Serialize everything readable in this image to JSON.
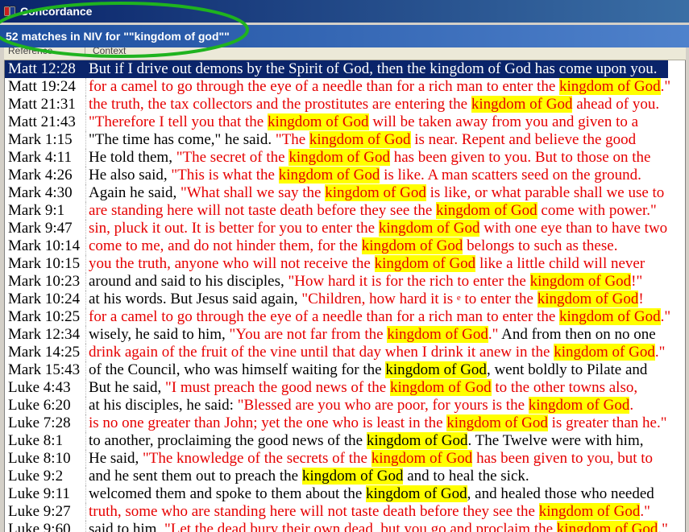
{
  "window": {
    "title": "Concordance",
    "icon": "book-icon"
  },
  "summary": "52 matches in NIV for \"\"kingdom of god\"\"",
  "columns": {
    "reference": "Reference",
    "context": "Context"
  },
  "colors": {
    "title_bar_start": "#0a246a",
    "title_bar_end": "#3a6ea5",
    "summary_bar_start": "#1d4e9e",
    "summary_bar_end": "#4f82cc",
    "selection": "#0a246a",
    "highlight": "#ffff00",
    "red_letter": "#e60000",
    "annotation": "#1fb31f"
  },
  "rows": [
    {
      "reference": "Matt 12:28",
      "selected": true,
      "segments": [
        {
          "text": "But if I drive out demons by the Spirit of God, then the kingdom of God has come upon you.",
          "color": "black"
        }
      ]
    },
    {
      "reference": "Matt 19:24",
      "segments": [
        {
          "text": "for a camel to go through the eye of a needle than for a rich man to enter the ",
          "color": "red"
        },
        {
          "text": "kingdom of God",
          "color": "red",
          "highlight": true
        },
        {
          "text": ".\"",
          "color": "red"
        }
      ]
    },
    {
      "reference": "Matt 21:31",
      "segments": [
        {
          "text": "the truth, the tax collectors and the prostitutes are entering the ",
          "color": "red"
        },
        {
          "text": "kingdom of God",
          "color": "red",
          "highlight": true
        },
        {
          "text": " ahead of you.",
          "color": "red"
        }
      ]
    },
    {
      "reference": "Matt 21:43",
      "segments": [
        {
          "text": "\"Therefore I tell you that the ",
          "color": "red"
        },
        {
          "text": "kingdom of God",
          "color": "red",
          "highlight": true
        },
        {
          "text": " will be taken away from you and given to a",
          "color": "red"
        }
      ]
    },
    {
      "reference": "Mark 1:15",
      "segments": [
        {
          "text": "\"The time has come,\" he said. ",
          "color": "black"
        },
        {
          "text": "\"The ",
          "color": "red"
        },
        {
          "text": "kingdom of God",
          "color": "red",
          "highlight": true
        },
        {
          "text": " is near. Repent and believe the good",
          "color": "red"
        }
      ]
    },
    {
      "reference": "Mark 4:11",
      "segments": [
        {
          "text": "He told them, ",
          "color": "black"
        },
        {
          "text": "\"The secret of the ",
          "color": "red"
        },
        {
          "text": "kingdom of God",
          "color": "red",
          "highlight": true
        },
        {
          "text": " has been given to you. But to those on the",
          "color": "red"
        }
      ]
    },
    {
      "reference": "Mark 4:26",
      "segments": [
        {
          "text": "He also said, ",
          "color": "black"
        },
        {
          "text": "\"This is what the ",
          "color": "red"
        },
        {
          "text": "kingdom of God",
          "color": "red",
          "highlight": true
        },
        {
          "text": " is like. A man scatters seed on the ground.",
          "color": "red"
        }
      ]
    },
    {
      "reference": "Mark 4:30",
      "segments": [
        {
          "text": "Again he said, ",
          "color": "black"
        },
        {
          "text": "\"What shall we say the ",
          "color": "red"
        },
        {
          "text": "kingdom of God",
          "color": "red",
          "highlight": true
        },
        {
          "text": " is like, or what parable shall we use to",
          "color": "red"
        }
      ]
    },
    {
      "reference": "Mark 9:1",
      "segments": [
        {
          "text": "are standing here will not taste death before they see the ",
          "color": "red"
        },
        {
          "text": "kingdom of God",
          "color": "red",
          "highlight": true
        },
        {
          "text": " come with power.\"",
          "color": "red"
        }
      ]
    },
    {
      "reference": "Mark 9:47",
      "segments": [
        {
          "text": "sin, pluck it out. It is better for you to enter the ",
          "color": "red"
        },
        {
          "text": "kingdom of God",
          "color": "red",
          "highlight": true
        },
        {
          "text": " with one eye than to have two",
          "color": "red"
        }
      ]
    },
    {
      "reference": "Mark 10:14",
      "segments": [
        {
          "text": "come to me, and do not hinder them, for the ",
          "color": "red"
        },
        {
          "text": "kingdom of God",
          "color": "red",
          "highlight": true
        },
        {
          "text": " belongs to such as these.",
          "color": "red"
        }
      ]
    },
    {
      "reference": "Mark 10:15",
      "segments": [
        {
          "text": "you the truth, anyone who will not receive the ",
          "color": "red"
        },
        {
          "text": "kingdom of God",
          "color": "red",
          "highlight": true
        },
        {
          "text": " like a little child will never",
          "color": "red"
        }
      ]
    },
    {
      "reference": "Mark 10:23",
      "segments": [
        {
          "text": "around and said to his disciples, ",
          "color": "black"
        },
        {
          "text": "\"How hard it is for the rich to enter the ",
          "color": "red"
        },
        {
          "text": "kingdom of God",
          "color": "red",
          "highlight": true
        },
        {
          "text": "!\"",
          "color": "red"
        }
      ]
    },
    {
      "reference": "Mark 10:24",
      "segments": [
        {
          "text": "at his words. But Jesus said again, ",
          "color": "black"
        },
        {
          "text": "\"Children, how hard it is ",
          "color": "red"
        },
        {
          "text": "e",
          "color": "red",
          "superscript": true
        },
        {
          "text": " to enter the ",
          "color": "red"
        },
        {
          "text": "kingdom of God",
          "color": "red",
          "highlight": true
        },
        {
          "text": "!",
          "color": "red"
        }
      ]
    },
    {
      "reference": "Mark 10:25",
      "segments": [
        {
          "text": "for a camel to go through the eye of a needle than for a rich man to enter the ",
          "color": "red"
        },
        {
          "text": "kingdom of God",
          "color": "red",
          "highlight": true
        },
        {
          "text": ".\"",
          "color": "red"
        }
      ]
    },
    {
      "reference": "Mark 12:34",
      "segments": [
        {
          "text": "wisely, he said to him, ",
          "color": "black"
        },
        {
          "text": "\"You are not far from the ",
          "color": "red"
        },
        {
          "text": "kingdom of God",
          "color": "red",
          "highlight": true
        },
        {
          "text": ".\"",
          "color": "red"
        },
        {
          "text": " And from then on no one",
          "color": "black"
        }
      ]
    },
    {
      "reference": "Mark 14:25",
      "segments": [
        {
          "text": "drink again of the fruit of the vine until that day when I drink it anew in the ",
          "color": "red"
        },
        {
          "text": "kingdom of God",
          "color": "red",
          "highlight": true
        },
        {
          "text": ".\"",
          "color": "red"
        }
      ]
    },
    {
      "reference": "Mark 15:43",
      "segments": [
        {
          "text": "of the Council, who was himself waiting for the ",
          "color": "black"
        },
        {
          "text": "kingdom of God",
          "color": "black",
          "highlight": true
        },
        {
          "text": ", went boldly to Pilate and",
          "color": "black"
        }
      ]
    },
    {
      "reference": "Luke 4:43",
      "segments": [
        {
          "text": "But he said, ",
          "color": "black"
        },
        {
          "text": "\"I must preach the good news of the ",
          "color": "red"
        },
        {
          "text": "kingdom of God",
          "color": "red",
          "highlight": true
        },
        {
          "text": " to the other towns also,",
          "color": "red"
        }
      ]
    },
    {
      "reference": "Luke 6:20",
      "segments": [
        {
          "text": "at his disciples, he said: ",
          "color": "black"
        },
        {
          "text": "\"Blessed are you who are poor, for yours is the ",
          "color": "red"
        },
        {
          "text": "kingdom of God",
          "color": "red",
          "highlight": true
        },
        {
          "text": ".",
          "color": "red"
        }
      ]
    },
    {
      "reference": "Luke 7:28",
      "segments": [
        {
          "text": "is no one greater than John; yet the one who is least in the ",
          "color": "red"
        },
        {
          "text": "kingdom of God",
          "color": "red",
          "highlight": true
        },
        {
          "text": " is greater than he.\"",
          "color": "red"
        }
      ]
    },
    {
      "reference": "Luke 8:1",
      "segments": [
        {
          "text": "to another, proclaiming the good news of the ",
          "color": "black"
        },
        {
          "text": "kingdom of God",
          "color": "black",
          "highlight": true
        },
        {
          "text": ". The Twelve were with him,",
          "color": "black"
        }
      ]
    },
    {
      "reference": "Luke 8:10",
      "segments": [
        {
          "text": "He said, ",
          "color": "black"
        },
        {
          "text": "\"The knowledge of the secrets of the ",
          "color": "red"
        },
        {
          "text": "kingdom of God",
          "color": "red",
          "highlight": true
        },
        {
          "text": " has been given to you, but to",
          "color": "red"
        }
      ]
    },
    {
      "reference": "Luke 9:2",
      "segments": [
        {
          "text": "and he sent them out to preach the ",
          "color": "black"
        },
        {
          "text": "kingdom of God",
          "color": "black",
          "highlight": true
        },
        {
          "text": " and to heal the sick.",
          "color": "black"
        }
      ]
    },
    {
      "reference": "Luke 9:11",
      "segments": [
        {
          "text": "welcomed them and spoke to them about the ",
          "color": "black"
        },
        {
          "text": "kingdom of God",
          "color": "black",
          "highlight": true
        },
        {
          "text": ", and healed those who needed",
          "color": "black"
        }
      ]
    },
    {
      "reference": "Luke 9:27",
      "segments": [
        {
          "text": "truth, some who are standing here will not taste death before they see the ",
          "color": "red"
        },
        {
          "text": "kingdom of God",
          "color": "red",
          "highlight": true
        },
        {
          "text": ".\"",
          "color": "red"
        }
      ]
    },
    {
      "reference": "Luke 9:60",
      "segments": [
        {
          "text": "said to him, ",
          "color": "black"
        },
        {
          "text": "\"Let the dead bury their own dead, but you go and proclaim the ",
          "color": "red"
        },
        {
          "text": "kingdom of God",
          "color": "red",
          "highlight": true
        },
        {
          "text": ".\"",
          "color": "red"
        }
      ]
    }
  ]
}
